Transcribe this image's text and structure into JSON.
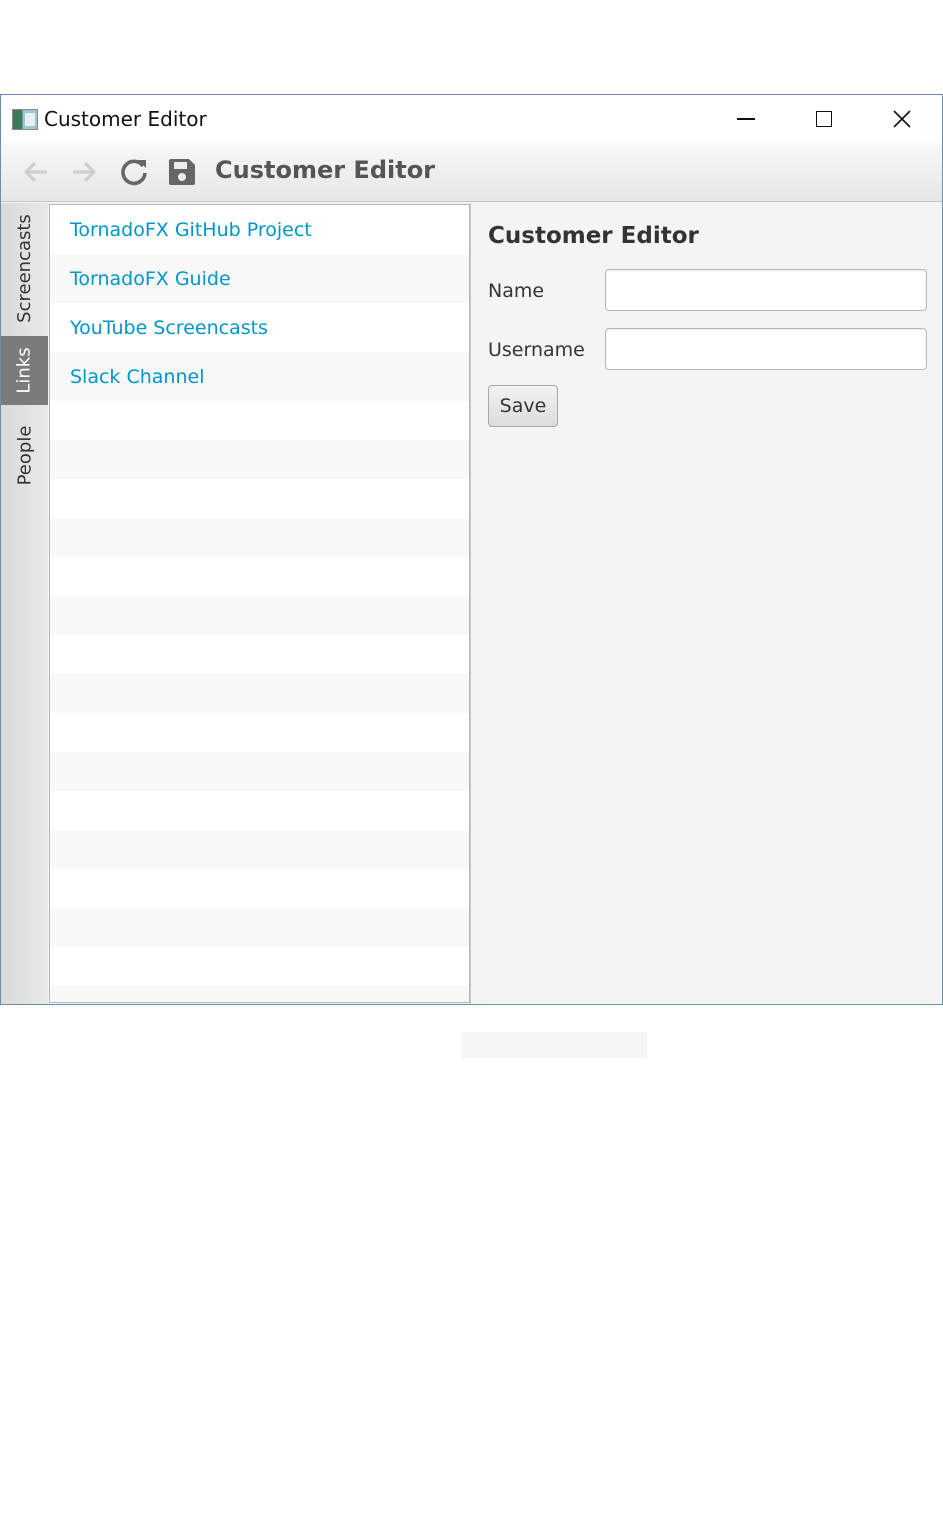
{
  "window": {
    "title": "Customer Editor",
    "controls": [
      "minimize-icon",
      "maximize-icon",
      "close-icon"
    ]
  },
  "toolbar": {
    "icons": [
      "back-arrow-icon",
      "forward-arrow-icon",
      "refresh-icon",
      "save-icon"
    ],
    "title": "Customer Editor"
  },
  "side_tabs": [
    {
      "label": "Screencasts",
      "active": false
    },
    {
      "label": "Links",
      "active": true
    },
    {
      "label": "People",
      "active": false
    }
  ],
  "links": [
    "TornadoFX GitHub Project",
    "TornadoFX Guide",
    "YouTube Screencasts",
    "Slack Channel"
  ],
  "editor": {
    "title": "Customer Editor",
    "name_label": "Name",
    "name_value": "",
    "username_label": "Username",
    "username_value": "",
    "save_label": "Save"
  },
  "colors": {
    "link": "#0096c9",
    "active_tab": "#7b7b7b",
    "window_border": "#6c8db3"
  }
}
